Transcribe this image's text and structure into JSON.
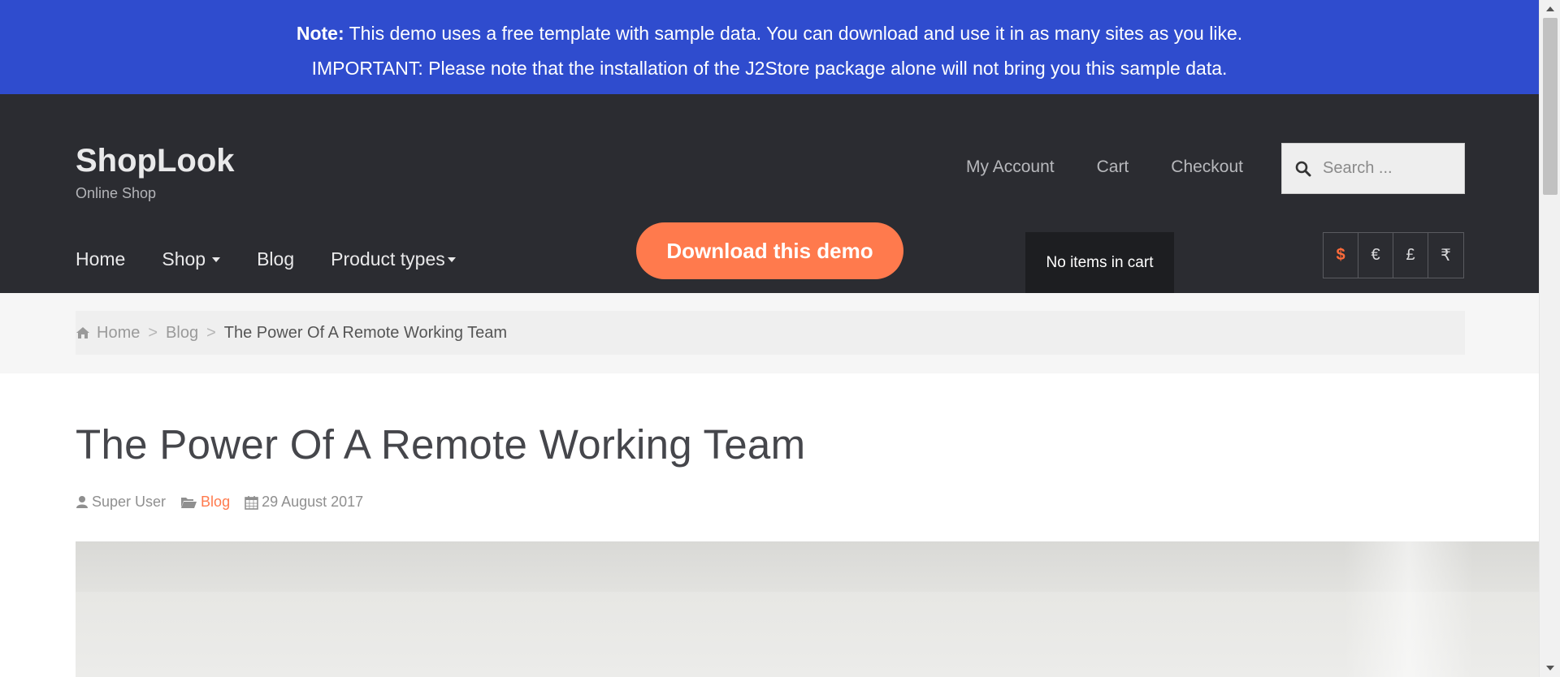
{
  "notice": {
    "note_label": "Note:",
    "line1": " This demo uses a free template with sample data. You can download and use it in as many sites as you like.",
    "line2": "IMPORTANT: Please note that the installation of the J2Store package alone will not bring you this sample data."
  },
  "brand": {
    "name": "ShopLook",
    "tagline": "Online Shop"
  },
  "top_links": [
    "My Account",
    "Cart",
    "Checkout"
  ],
  "search": {
    "placeholder": "Search ..."
  },
  "main_nav": {
    "home": "Home",
    "shop": "Shop",
    "blog": "Blog",
    "product_types": "Product types"
  },
  "download_button": "Download this demo",
  "cart_status": "No items in cart",
  "currencies": {
    "usd": "$",
    "eur": "€",
    "gbp": "£",
    "inr": "₹",
    "active": "usd",
    "active_color": "#ff6b3a"
  },
  "breadcrumb": {
    "home": "Home",
    "blog": "Blog",
    "current": "The Power Of A Remote Working Team",
    "separator": ">"
  },
  "article": {
    "title": "The Power Of A Remote Working Team",
    "author": "Super User",
    "category": "Blog",
    "date": "29 August 2017"
  },
  "colors": {
    "banner": "#2f4cce",
    "header": "#2b2c31",
    "accent": "#ff7a4d"
  }
}
